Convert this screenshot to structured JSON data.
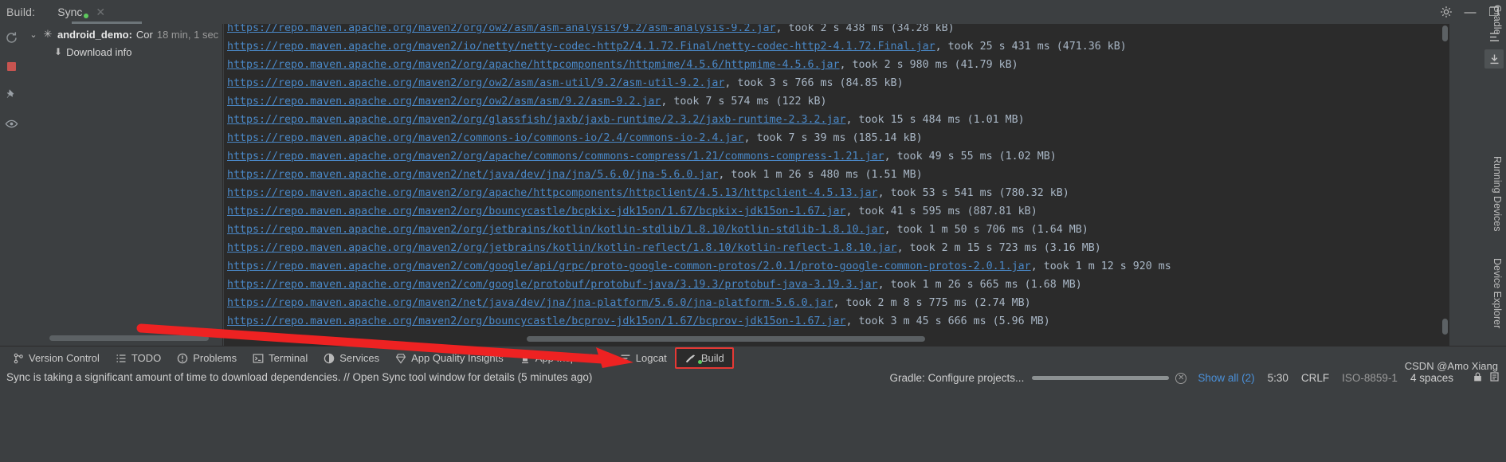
{
  "window": {
    "build_label": "Build:",
    "tab_label": "Sync",
    "close_glyph": "✕",
    "settings_icon": "⚙",
    "minimize_glyph": "—",
    "maximize_glyph": "❐"
  },
  "left_rail": {
    "items": [
      {
        "name": "rerun-icon",
        "glyph": "⟳"
      },
      {
        "name": "stop-icon",
        "glyph": ""
      },
      {
        "name": "pin-icon",
        "glyph": "📌"
      },
      {
        "name": "eye-icon",
        "glyph": "👁"
      }
    ]
  },
  "tree": {
    "root": {
      "chevron": "⌄",
      "spinner": "✳",
      "title": "android_demo:",
      "subtitle": "Cor",
      "duration": "18 min, 1 sec"
    },
    "child": {
      "icon": "⬇",
      "label": "Download info"
    }
  },
  "console": {
    "lines": [
      {
        "url": "https://repo.maven.apache.org/maven2/org/ow2/asm/asm-analysis/9.2/asm-analysis-9.2.jar",
        "meta": ", took 2 s 438 ms (34.28 kB)",
        "clipped_top": true
      },
      {
        "url": "https://repo.maven.apache.org/maven2/io/netty/netty-codec-http2/4.1.72.Final/netty-codec-http2-4.1.72.Final.jar",
        "meta": ", took 25 s 431 ms (471.36 kB)"
      },
      {
        "url": "https://repo.maven.apache.org/maven2/org/apache/httpcomponents/httpmime/4.5.6/httpmime-4.5.6.jar",
        "meta": ", took 2 s 980 ms (41.79 kB)"
      },
      {
        "url": "https://repo.maven.apache.org/maven2/org/ow2/asm/asm-util/9.2/asm-util-9.2.jar",
        "meta": ", took 3 s 766 ms (84.85 kB)"
      },
      {
        "url": "https://repo.maven.apache.org/maven2/org/ow2/asm/asm/9.2/asm-9.2.jar",
        "meta": ", took 7 s 574 ms (122 kB)"
      },
      {
        "url": "https://repo.maven.apache.org/maven2/org/glassfish/jaxb/jaxb-runtime/2.3.2/jaxb-runtime-2.3.2.jar",
        "meta": ", took 15 s 484 ms (1.01 MB)"
      },
      {
        "url": "https://repo.maven.apache.org/maven2/commons-io/commons-io/2.4/commons-io-2.4.jar",
        "meta": ", took 7 s 39 ms (185.14 kB)"
      },
      {
        "url": "https://repo.maven.apache.org/maven2/org/apache/commons/commons-compress/1.21/commons-compress-1.21.jar",
        "meta": ", took 49 s 55 ms (1.02 MB)"
      },
      {
        "url": "https://repo.maven.apache.org/maven2/net/java/dev/jna/jna/5.6.0/jna-5.6.0.jar",
        "meta": ", took 1 m 26 s 480 ms (1.51 MB)"
      },
      {
        "url": "https://repo.maven.apache.org/maven2/org/apache/httpcomponents/httpclient/4.5.13/httpclient-4.5.13.jar",
        "meta": ", took 53 s 541 ms (780.32 kB)"
      },
      {
        "url": "https://repo.maven.apache.org/maven2/org/bouncycastle/bcpkix-jdk15on/1.67/bcpkix-jdk15on-1.67.jar",
        "meta": ", took 41 s 595 ms (887.81 kB)"
      },
      {
        "url": "https://repo.maven.apache.org/maven2/org/jetbrains/kotlin/kotlin-stdlib/1.8.10/kotlin-stdlib-1.8.10.jar",
        "meta": ", took 1 m 50 s 706 ms (1.64 MB)"
      },
      {
        "url": "https://repo.maven.apache.org/maven2/org/jetbrains/kotlin/kotlin-reflect/1.8.10/kotlin-reflect-1.8.10.jar",
        "meta": ", took 2 m 15 s 723 ms (3.16 MB)"
      },
      {
        "url": "https://repo.maven.apache.org/maven2/com/google/api/grpc/proto-google-common-protos/2.0.1/proto-google-common-protos-2.0.1.jar",
        "meta": ", took 1 m 12 s 920 ms"
      },
      {
        "url": "https://repo.maven.apache.org/maven2/com/google/protobuf/protobuf-java/3.19.3/protobuf-java-3.19.3.jar",
        "meta": ", took 1 m 26 s 665 ms (1.68 MB)"
      },
      {
        "url": "https://repo.maven.apache.org/maven2/net/java/dev/jna/jna-platform/5.6.0/jna-platform-5.6.0.jar",
        "meta": ", took 2 m 8 s 775 ms (2.74 MB)"
      },
      {
        "url": "https://repo.maven.apache.org/maven2/org/bouncycastle/bcprov-jdk15on/1.67/bcprov-jdk15on-1.67.jar",
        "meta": ", took 3 m 45 s 666 ms (5.96 MB)"
      }
    ]
  },
  "right_rail": {
    "buttons": [
      {
        "name": "hide-icon",
        "glyph": "⇥"
      },
      {
        "name": "download-sources-icon",
        "glyph": "⤓"
      }
    ],
    "labels": {
      "gradle": "Gradle",
      "running_devices": "Running Devices",
      "device_explorer": "Device Explorer"
    }
  },
  "tool_window_bar": {
    "items": [
      {
        "name": "version-control",
        "label": "Version Control",
        "icon": "⑂",
        "selected": false
      },
      {
        "name": "todo",
        "label": "TODO",
        "icon": "☰",
        "selected": false
      },
      {
        "name": "problems",
        "label": "Problems",
        "icon": "❶",
        "selected": false
      },
      {
        "name": "terminal",
        "label": "Terminal",
        "icon": "▣",
        "selected": false
      },
      {
        "name": "services",
        "label": "Services",
        "icon": "◐",
        "selected": false
      },
      {
        "name": "app-quality-insights",
        "label": "App Quality Insights",
        "icon": "♢",
        "selected": false
      },
      {
        "name": "app-inspection",
        "label": "App Inspection",
        "icon": "♟",
        "selected": false
      },
      {
        "name": "logcat",
        "label": "Logcat",
        "icon": "☰",
        "selected": false
      },
      {
        "name": "build",
        "label": "Build",
        "icon": "🔨",
        "selected": true
      }
    ]
  },
  "status_bar": {
    "message": "Sync is taking a significant amount of time to download dependencies. // Open Sync tool window for details (5 minutes ago)",
    "gradle_task": "Gradle: Configure projects...",
    "cancel_glyph": "✕",
    "show_all": "Show all (2)",
    "caret_position": "5:30",
    "line_separator": "CRLF",
    "encoding": "ISO-8859-1",
    "indent": "4 spaces",
    "lock_icon": "🔒",
    "notifications_icon": "🗈",
    "watermark": "CSDN @Amo Xiang"
  },
  "colors": {
    "panel_bg": "#3c3f41",
    "console_bg": "#2b2b2b",
    "link": "#4a88c7",
    "meta_text": "#a9b7c6",
    "accent_red": "#e53935",
    "green_dot": "#5ec95e",
    "link_blue_status": "#4a90d9"
  }
}
